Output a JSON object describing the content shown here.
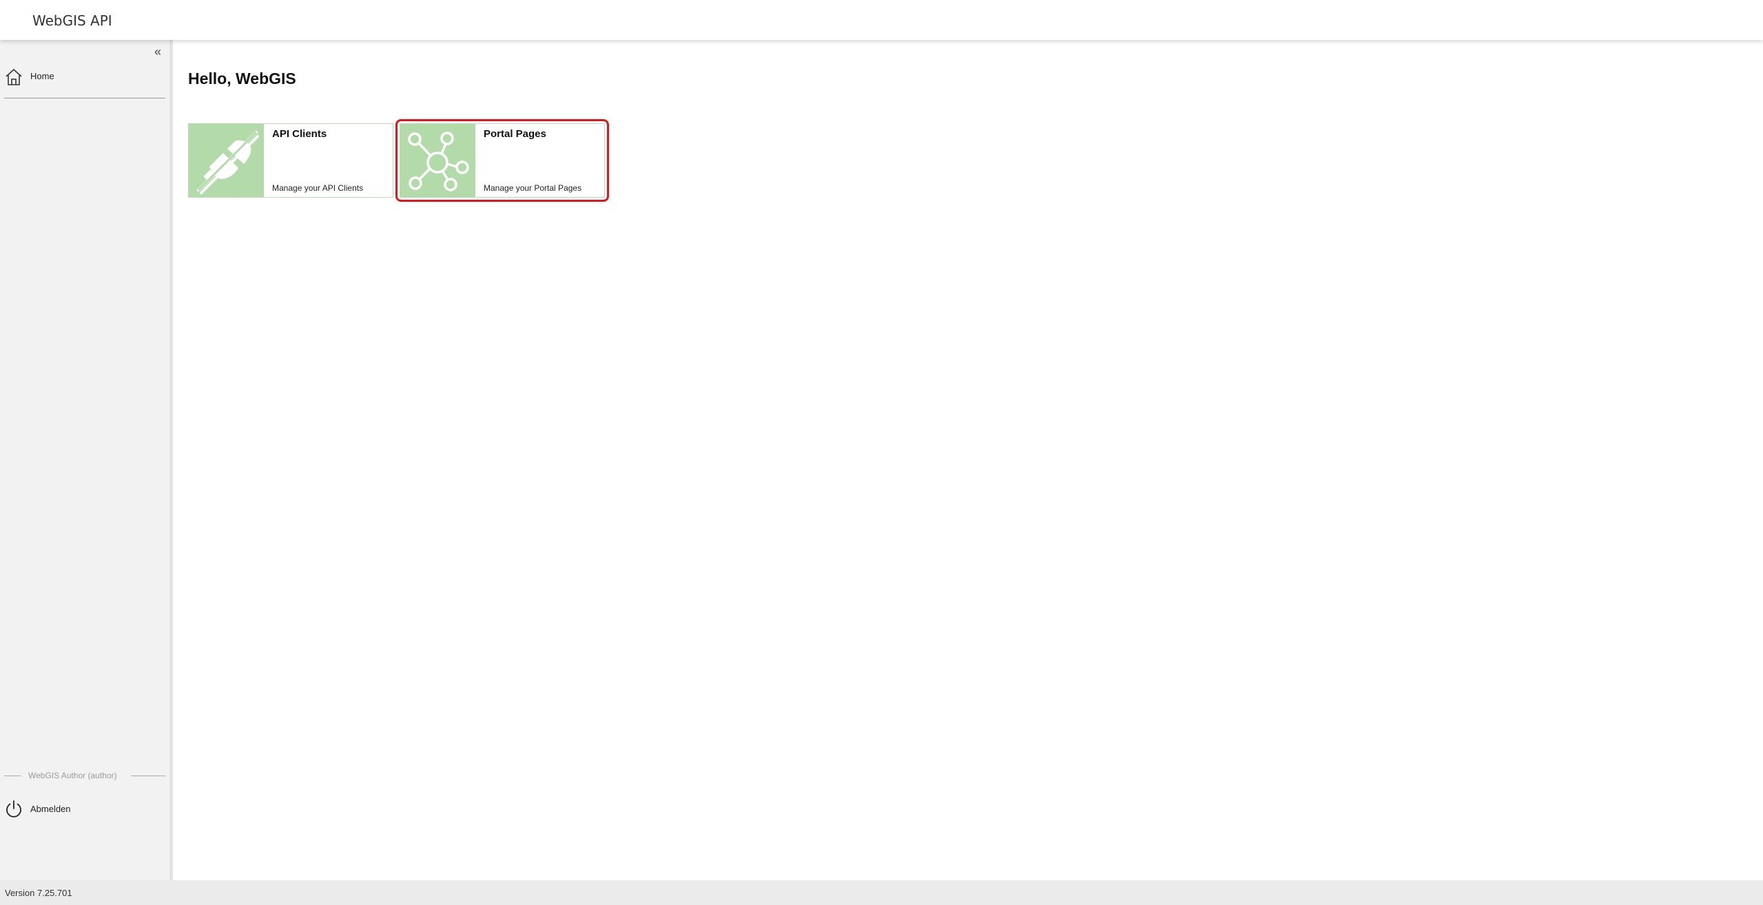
{
  "header": {
    "app_title": "WebGIS API"
  },
  "sidebar": {
    "collapse_label": "«",
    "items": [
      {
        "label": "Home",
        "icon": "home-icon"
      }
    ],
    "user_label": "WebGIS Author (author)",
    "logout": {
      "label": "Abmelden",
      "icon": "power-icon"
    }
  },
  "main": {
    "greeting": "Hello, WebGIS",
    "tiles": [
      {
        "title": "API Clients",
        "description": "Manage your API Clients",
        "icon": "plug-disconnected-icon",
        "selected": false
      },
      {
        "title": "Portal Pages",
        "description": "Manage your Portal Pages",
        "icon": "network-hub-icon",
        "selected": true
      }
    ]
  },
  "footer": {
    "version": "Version 7.25.701"
  },
  "colors": {
    "tile_image_bg": "#b3dbaa",
    "tile_border": "#b9dbb2",
    "selection_outline": "#e0161c",
    "sidebar_bg": "#f2f2f2",
    "footer_bg": "#ebebeb"
  }
}
